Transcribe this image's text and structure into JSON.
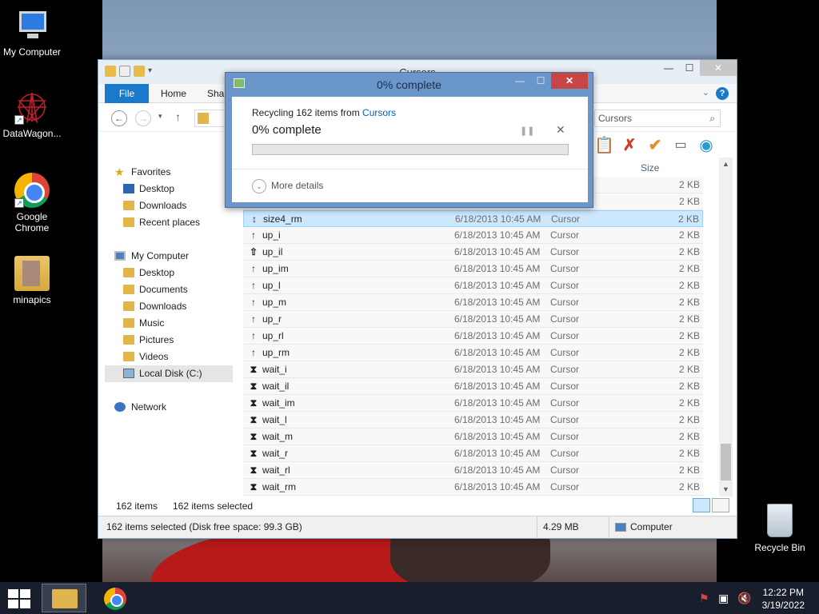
{
  "desktop": {
    "icons": [
      {
        "label": "My Computer"
      },
      {
        "label": "DataWagon..."
      },
      {
        "label": "Google\nChrome"
      },
      {
        "label": "minapics"
      }
    ],
    "recycle_bin": "Recycle Bin"
  },
  "explorer": {
    "title": "Cursors",
    "tabs": {
      "file": "File",
      "home": "Home",
      "share": "Shar"
    },
    "search_placeholder": "Cursors",
    "column_size": "Size",
    "nav": {
      "favorites": "Favorites",
      "fav_items": [
        "Desktop",
        "Downloads",
        "Recent places"
      ],
      "my_computer": "My Computer",
      "pc_items": [
        "Desktop",
        "Documents",
        "Downloads",
        "Music",
        "Pictures",
        "Videos",
        "Local Disk (C:)"
      ],
      "network": "Network"
    },
    "files": [
      {
        "name": "",
        "date": "",
        "type": "",
        "size": "2 KB",
        "cursor": ""
      },
      {
        "name": "",
        "date": "",
        "type": "",
        "size": "2 KB",
        "cursor": ""
      },
      {
        "name": "size4_rm",
        "date": "6/18/2013 10:45 AM",
        "type": "Cursor",
        "size": "2 KB",
        "cursor": "↕"
      },
      {
        "name": "up_i",
        "date": "6/18/2013 10:45 AM",
        "type": "Cursor",
        "size": "2 KB",
        "cursor": "↑"
      },
      {
        "name": "up_il",
        "date": "6/18/2013 10:45 AM",
        "type": "Cursor",
        "size": "2 KB",
        "cursor": "⇧"
      },
      {
        "name": "up_im",
        "date": "6/18/2013 10:45 AM",
        "type": "Cursor",
        "size": "2 KB",
        "cursor": "↑"
      },
      {
        "name": "up_l",
        "date": "6/18/2013 10:45 AM",
        "type": "Cursor",
        "size": "2 KB",
        "cursor": "↑"
      },
      {
        "name": "up_m",
        "date": "6/18/2013 10:45 AM",
        "type": "Cursor",
        "size": "2 KB",
        "cursor": "↑"
      },
      {
        "name": "up_r",
        "date": "6/18/2013 10:45 AM",
        "type": "Cursor",
        "size": "2 KB",
        "cursor": "↑"
      },
      {
        "name": "up_rl",
        "date": "6/18/2013 10:45 AM",
        "type": "Cursor",
        "size": "2 KB",
        "cursor": "↑"
      },
      {
        "name": "up_rm",
        "date": "6/18/2013 10:45 AM",
        "type": "Cursor",
        "size": "2 KB",
        "cursor": "↑"
      },
      {
        "name": "wait_i",
        "date": "6/18/2013 10:45 AM",
        "type": "Cursor",
        "size": "2 KB",
        "cursor": "⧗"
      },
      {
        "name": "wait_il",
        "date": "6/18/2013 10:45 AM",
        "type": "Cursor",
        "size": "2 KB",
        "cursor": "⧗"
      },
      {
        "name": "wait_im",
        "date": "6/18/2013 10:45 AM",
        "type": "Cursor",
        "size": "2 KB",
        "cursor": "⧗"
      },
      {
        "name": "wait_l",
        "date": "6/18/2013 10:45 AM",
        "type": "Cursor",
        "size": "2 KB",
        "cursor": "⧗"
      },
      {
        "name": "wait_m",
        "date": "6/18/2013 10:45 AM",
        "type": "Cursor",
        "size": "2 KB",
        "cursor": "⧗"
      },
      {
        "name": "wait_r",
        "date": "6/18/2013 10:45 AM",
        "type": "Cursor",
        "size": "2 KB",
        "cursor": "⧗"
      },
      {
        "name": "wait_rl",
        "date": "6/18/2013 10:45 AM",
        "type": "Cursor",
        "size": "2 KB",
        "cursor": "⧗"
      },
      {
        "name": "wait_rm",
        "date": "6/18/2013 10:45 AM",
        "type": "Cursor",
        "size": "2 KB",
        "cursor": "⧗"
      }
    ],
    "status_count": "162 items",
    "status_selected": "162 items selected",
    "status_detail": "162 items selected (Disk free space: 99.3 GB)",
    "status_size": "4.29 MB",
    "status_location": "Computer"
  },
  "dialog": {
    "title": "0% complete",
    "line_prefix": "Recycling 162 items from ",
    "line_link": "Cursors",
    "progress_text": "0% complete",
    "progress_fraction": 0,
    "more_details": "More details"
  },
  "taskbar": {
    "time": "12:22 PM",
    "date": "3/19/2022"
  }
}
